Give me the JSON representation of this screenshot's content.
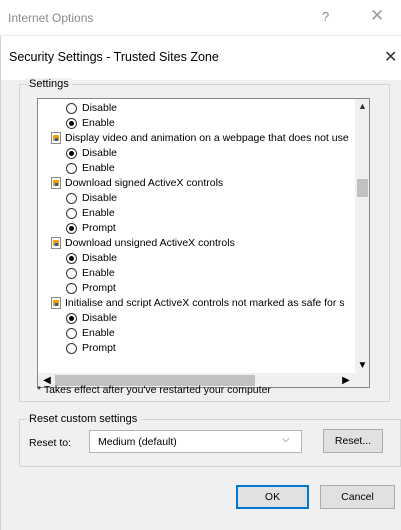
{
  "background_window": {
    "title": "Internet Options",
    "help_glyph": "?",
    "close_glyph": "✕"
  },
  "dialog": {
    "title": "Security Settings - Trusted Sites Zone",
    "close_glyph": "✕"
  },
  "settings_group": {
    "label": "Settings",
    "rows": [
      {
        "kind": "radio",
        "label": "Disable",
        "checked": false
      },
      {
        "kind": "radio",
        "label": "Enable",
        "checked": true
      },
      {
        "kind": "category",
        "label": "Display video and animation on a webpage that does not use"
      },
      {
        "kind": "radio",
        "label": "Disable",
        "checked": true
      },
      {
        "kind": "radio",
        "label": "Enable",
        "checked": false
      },
      {
        "kind": "category",
        "label": "Download signed ActiveX controls"
      },
      {
        "kind": "radio",
        "label": "Disable",
        "checked": false
      },
      {
        "kind": "radio",
        "label": "Enable",
        "checked": false
      },
      {
        "kind": "radio",
        "label": "Prompt",
        "checked": true
      },
      {
        "kind": "category",
        "label": "Download unsigned ActiveX controls"
      },
      {
        "kind": "radio",
        "label": "Disable",
        "checked": true
      },
      {
        "kind": "radio",
        "label": "Enable",
        "checked": false
      },
      {
        "kind": "radio",
        "label": "Prompt",
        "checked": false
      },
      {
        "kind": "category",
        "label": "Initialise and script ActiveX controls not marked as safe for s"
      },
      {
        "kind": "radio",
        "label": "Disable",
        "checked": true
      },
      {
        "kind": "radio",
        "label": "Enable",
        "checked": false
      },
      {
        "kind": "radio",
        "label": "Prompt",
        "checked": false
      }
    ],
    "note": "* Takes effect after you've restarted your computer"
  },
  "reset_group": {
    "label": "Reset custom settings",
    "reset_to_label": "Reset to:",
    "dropdown_value": "Medium (default)",
    "reset_button": "Reset..."
  },
  "footer": {
    "ok_button": "OK",
    "cancel_button": "Cancel"
  },
  "colors": {
    "dialog_bg": "#f0f0f0",
    "default_button_border": "#0078d7",
    "scroll_thumb": "#c1c1c1"
  }
}
